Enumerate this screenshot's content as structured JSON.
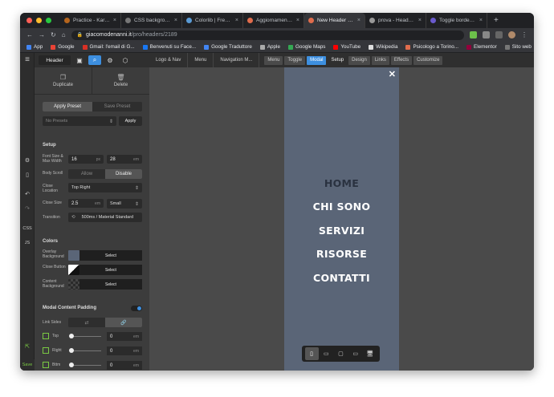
{
  "browser": {
    "tabs": [
      {
        "label": "Practice - Karen J.",
        "active": false
      },
      {
        "label": "CSS background-c...",
        "active": false
      },
      {
        "label": "Colorlib | Free Boot...",
        "active": false
      },
      {
        "label": "Aggiornamenti di W...",
        "active": false
      },
      {
        "label": "New Header - Head...",
        "active": true
      },
      {
        "label": "prova - Headers - F...",
        "active": false
      },
      {
        "label": "Toggle border CSS...",
        "active": false
      }
    ],
    "url_domain": "giacomodenanni.it",
    "url_path": "/pro/headers/2189",
    "bookmarks": [
      "App",
      "Google",
      "Gmail: l'email di G...",
      "Benvenuti su Face...",
      "Google Traduttore",
      "Apple",
      "Google Maps",
      "YouTube",
      "Wikipedia",
      "Psicologo a Torino...",
      "Elementor",
      "Sito web"
    ]
  },
  "toolbar": {
    "header_label": "Header",
    "duplicate": "Duplicate",
    "delete": "Delete"
  },
  "breadcrumb": [
    "Logo & Nav",
    "Menu",
    "Navigation M..."
  ],
  "canvas_tabs": [
    {
      "label": "Menu",
      "state": "normal"
    },
    {
      "label": "Toggle",
      "state": "normal"
    },
    {
      "label": "Modal",
      "state": "active"
    },
    {
      "label": "Setup",
      "state": "plain"
    },
    {
      "label": "Design",
      "state": "normal"
    },
    {
      "label": "Links",
      "state": "normal"
    },
    {
      "label": "Effects",
      "state": "normal"
    },
    {
      "label": "Customize",
      "state": "normal"
    }
  ],
  "preset": {
    "apply": "Apply Preset",
    "save": "Save Preset",
    "placeholder": "No Presets",
    "apply_btn": "Apply"
  },
  "setup": {
    "heading": "Setup",
    "font_size_label": "Font Size & Max Width",
    "font_size_value": "16",
    "font_size_unit": "px",
    "max_width_value": "28",
    "max_width_unit": "em",
    "body_scroll_label": "Body Scroll",
    "allow": "Allow",
    "disable": "Disable",
    "close_location_label": "Close Location",
    "close_location_value": "Top Right",
    "close_size_label": "Close Size",
    "close_size_value": "2.5",
    "close_size_unit": "em",
    "close_size_select": "Small",
    "transition_label": "Transition",
    "transition_value": "500ms / Material Standard"
  },
  "colors": {
    "heading": "Colors",
    "overlay_label": "Overlay Background",
    "close_label": "Close Button",
    "content_label": "Content Background",
    "select": "Select",
    "overlay_color": "#5a6577"
  },
  "padding": {
    "heading": "Modal Content Padding",
    "link_sides": "Link Sides",
    "rows": [
      {
        "label": "Top",
        "value": "0",
        "unit": "em"
      },
      {
        "label": "Right",
        "value": "0",
        "unit": "em"
      },
      {
        "label": "Bttm",
        "value": "0",
        "unit": "em"
      }
    ]
  },
  "rail": {
    "css": "CSS",
    "js": "JS",
    "save": "Save"
  },
  "preview": {
    "menu": [
      "HOME",
      "CHI SONO",
      "SERVIZI",
      "RISORSE",
      "CONTATTI"
    ],
    "close": "✕"
  }
}
